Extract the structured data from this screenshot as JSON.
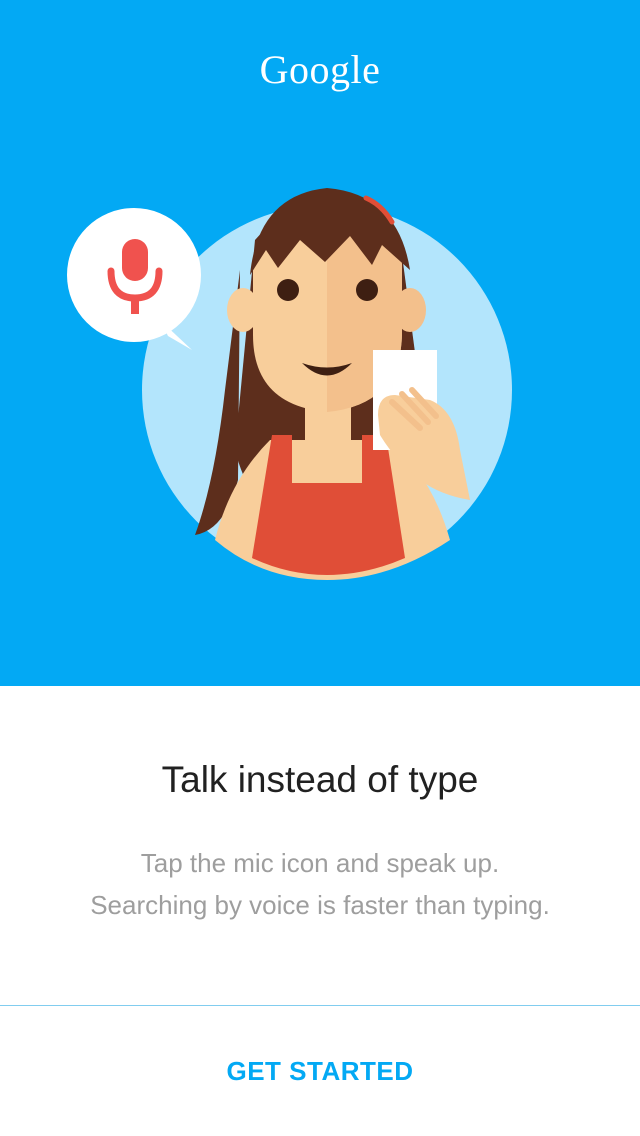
{
  "brand": {
    "logo_text": "Google"
  },
  "illustration": {
    "speech_bubble_icon": "mic-icon",
    "subject": "woman-holding-phone"
  },
  "onboarding": {
    "title": "Talk instead of type",
    "description_line1": "Tap the mic icon and speak up.",
    "description_line2": "Searching by voice is faster than typing."
  },
  "actions": {
    "get_started_label": "GET STARTED"
  },
  "colors": {
    "hero_background": "#03A9F4",
    "accent": "#03A9F4",
    "circle": "#B3E5FC",
    "mic": "#F0524E",
    "hair": "#5D2E1C",
    "skin": "#F8CE9B",
    "dress": "#E04E37"
  }
}
